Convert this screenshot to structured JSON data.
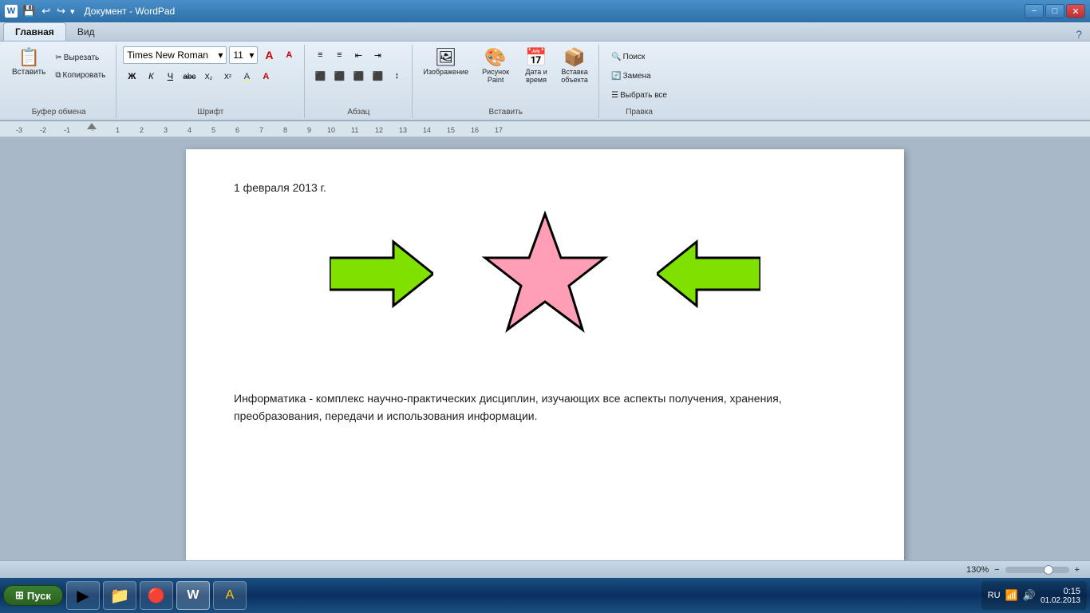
{
  "titleBar": {
    "title": "Документ - WordPad",
    "icon": "W",
    "controls": {
      "minimize": "−",
      "maximize": "□",
      "close": "✕"
    }
  },
  "quickAccess": {
    "buttons": [
      "💾",
      "↩",
      "↪",
      "▾"
    ]
  },
  "ribbonTabs": {
    "tabs": [
      "Главная",
      "Вид"
    ],
    "activeTab": "Главная",
    "helpBtn": "?"
  },
  "ribbon": {
    "groups": [
      {
        "label": "Буфер обмена",
        "paste": "Вставить",
        "cut": "Вырезать",
        "copy": "Копировать"
      },
      {
        "label": "Шрифт",
        "fontName": "Times New Roman",
        "fontSize": "11",
        "formatButtons": [
          "Ж",
          "К",
          "Ч",
          "abc",
          "Х₂",
          "Х²"
        ],
        "colorButtons": [
          "A",
          "A"
        ]
      },
      {
        "label": "Абзац",
        "alignButtons": [
          "≡",
          "≡",
          "≡",
          "≡",
          "≡"
        ]
      },
      {
        "label": "Вставить",
        "buttons": [
          "Изображение",
          "Рисунок Paint",
          "Дата и время",
          "Вставка объекта"
        ]
      },
      {
        "label": "Правка",
        "buttons": [
          "🔍 Поиск",
          "🔄 Замена",
          "☰ Выбрать все"
        ]
      }
    ]
  },
  "ruler": {
    "marks": [
      "-3",
      "-2",
      "-1",
      "·",
      "1",
      "2",
      "3",
      "4",
      "5",
      "6",
      "7",
      "8",
      "9",
      "10",
      "11",
      "12",
      "13",
      "14",
      "15",
      "16",
      "17"
    ]
  },
  "document": {
    "date": "1 февраля 2013 г.",
    "bodyText": "Информатика - комплекс научно-практических дисциплин, изучающих все аспекты получения, хранения, преобразования, передачи и использования информации.",
    "shapes": {
      "arrowColor": "#80e000",
      "arrowBorderColor": "#000000",
      "starColor": "#ff9eb5",
      "starBorderColor": "#000000"
    }
  },
  "statusBar": {
    "zoom": "130%",
    "zoomMinus": "−",
    "zoomPlus": "+"
  },
  "taskbar": {
    "startLabel": "Пуск",
    "buttons": [
      "🎵",
      "📁",
      "🔴",
      "W",
      "A"
    ],
    "tray": {
      "time": "0:15",
      "date": "01.02.2013",
      "lang": "RU"
    }
  }
}
